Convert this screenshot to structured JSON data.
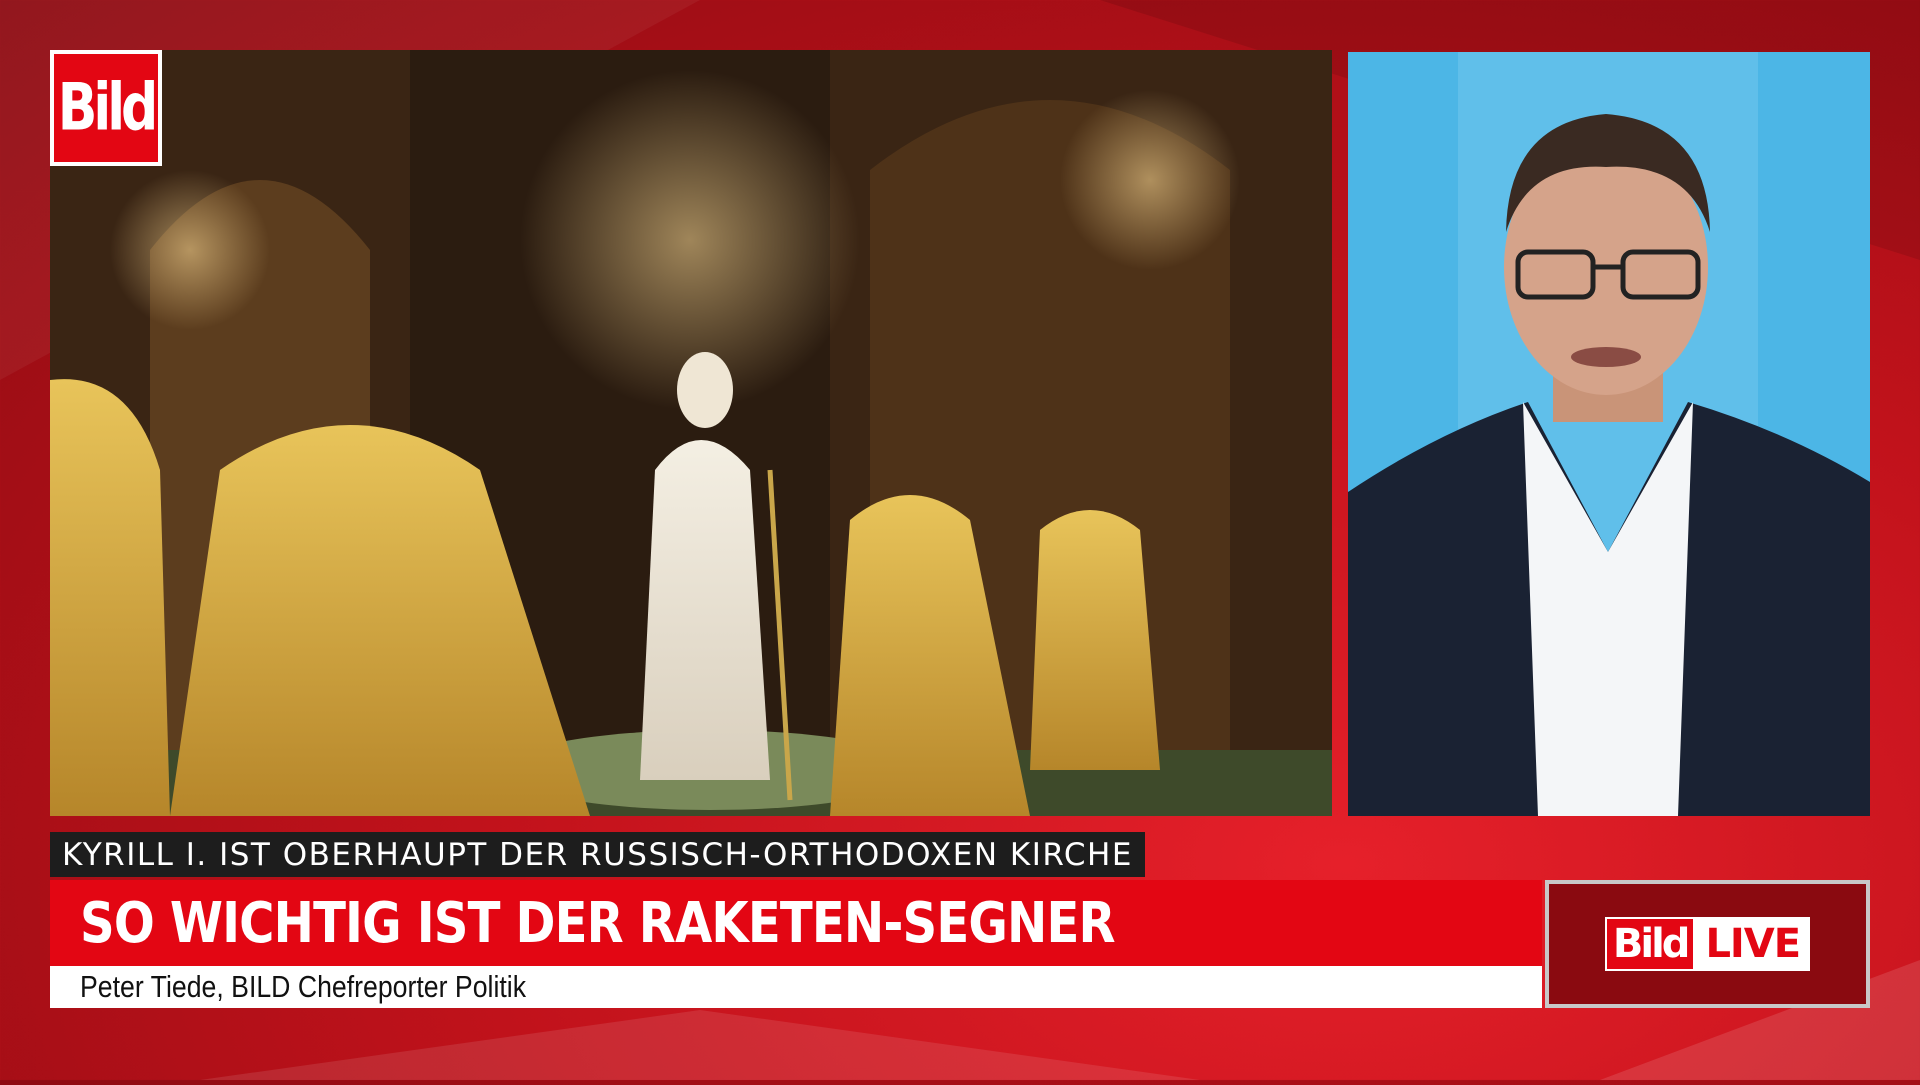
{
  "brand": {
    "logo_text": "Bild",
    "live_logo_text": "Bild",
    "live_suffix": "LIVE"
  },
  "lower_third": {
    "topic": "KYRILL I. IST OBERHAUPT DER RUSSISCH-ORTHODOXEN KIRCHE",
    "headline": "SO WICHTIG IST DER RAKETEN-SEGNER",
    "byline": "Peter Tiede, BILD Chefreporter Politik"
  },
  "colors": {
    "brand_red": "#e30613",
    "topic_bar": "#1d1d1d",
    "studio_blue": "#4cb6e6"
  }
}
